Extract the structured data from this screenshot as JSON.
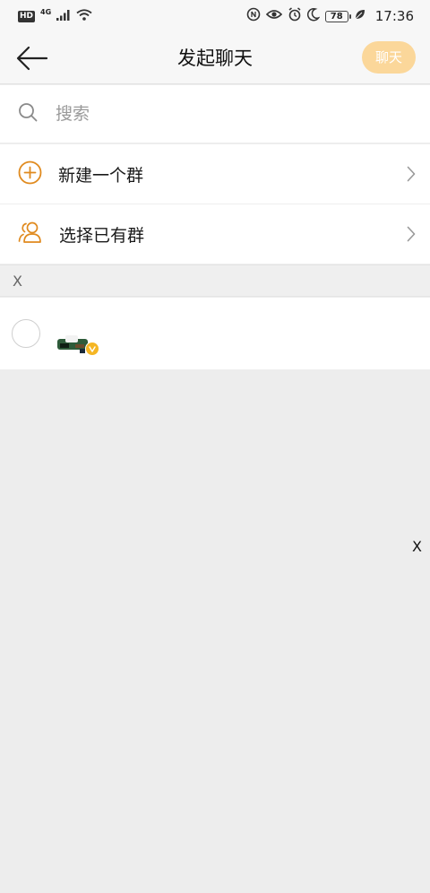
{
  "status_bar": {
    "hd": "HD",
    "network": "4G",
    "battery": "78",
    "time": "17:36"
  },
  "nav": {
    "title": "发起聊天",
    "chat_button": "聊天",
    "back_icon": "arrow-left-icon"
  },
  "search": {
    "placeholder": "搜索",
    "value": "",
    "icon": "search-icon"
  },
  "menu": {
    "new_group": "新建一个群",
    "select_group": "选择已有群"
  },
  "section": {
    "letter": "X"
  },
  "index_bar": {
    "letter": "X"
  },
  "colors": {
    "accent": "#e08a1e",
    "chat_button_disabled": "#fbd79a",
    "badge": "#f5b623"
  }
}
